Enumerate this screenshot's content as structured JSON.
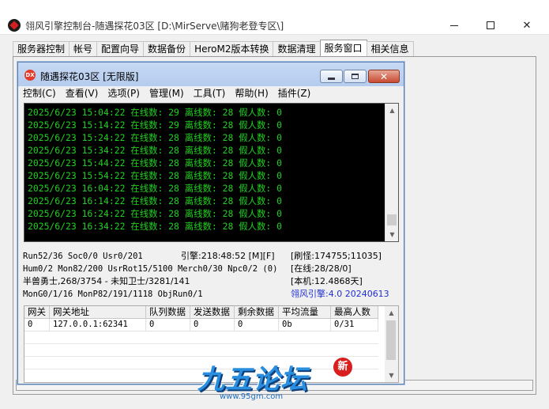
{
  "window": {
    "title": "翎风引擎控制台-随遇探花03区 [D:\\MirServe\\赌狗老登专区\\]"
  },
  "tabs": [
    "服务器控制",
    "帐号",
    "配置向导",
    "数据备份",
    "HeroM2版本转换",
    "数据清理",
    "服务窗口",
    "相关信息"
  ],
  "active_tab": "服务窗口",
  "inner": {
    "icon_text": "DX",
    "title": "随遇探花03区 [无限版]",
    "menu": [
      "控制(C)",
      "查看(V)",
      "选项(P)",
      "管理(M)",
      "工具(T)",
      "帮助(H)",
      "插件(Z)"
    ]
  },
  "log": [
    "2025/6/23 15:04:22 在线数: 29 离线数: 28 假人数: 0",
    "2025/6/23 15:14:22 在线数: 29 离线数: 28 假人数: 0",
    "2025/6/23 15:24:22 在线数: 28 离线数: 28 假人数: 0",
    "2025/6/23 15:34:22 在线数: 28 离线数: 28 假人数: 0",
    "2025/6/23 15:44:22 在线数: 28 离线数: 28 假人数: 0",
    "2025/6/23 15:54:22 在线数: 28 离线数: 28 假人数: 0",
    "2025/6/23 16:04:22 在线数: 28 离线数: 28 假人数: 0",
    "2025/6/23 16:14:22 在线数: 28 离线数: 28 假人数: 0",
    "2025/6/23 16:24:22 在线数: 28 离线数: 28 假人数: 0",
    "2025/6/23 16:34:22 在线数: 28 离线数: 28 假人数: 0"
  ],
  "stats": {
    "line1": "Run52/36 Soc0/0 Usr0/201",
    "engine": "引擎:218:48:52 [M][F]",
    "refresh": "[刷怪:174755;11035]",
    "line2": "Hum0/2 Mon82/200 UsrRot15/5100 Merch0/30 Npc0/2 (0)",
    "online": "[在线:28/28/0]",
    "line3": "半兽勇士,268/3754 - 未知卫士/3281/141",
    "local": "[本机:12.4868天]",
    "line4": "MonG0/1/16 MonP82/191/1118 ObjRun0/1",
    "version": "翎风引擎:4.0 20240613"
  },
  "grid": {
    "headers": [
      "网关",
      "网关地址",
      "队列数据",
      "发送数据",
      "剩余数据",
      "平均流量",
      "最高人数"
    ],
    "rows": [
      [
        "0",
        "127.0.0.1:62341",
        "0",
        "0",
        "0",
        "0b",
        "0/31"
      ]
    ]
  },
  "watermark": {
    "brand": "九五论坛",
    "seal": "新",
    "url": "www.95gm.com"
  },
  "colors": {
    "log_text": "#20d020",
    "log_bg": "#000000",
    "version_text": "#1f2fd0"
  }
}
